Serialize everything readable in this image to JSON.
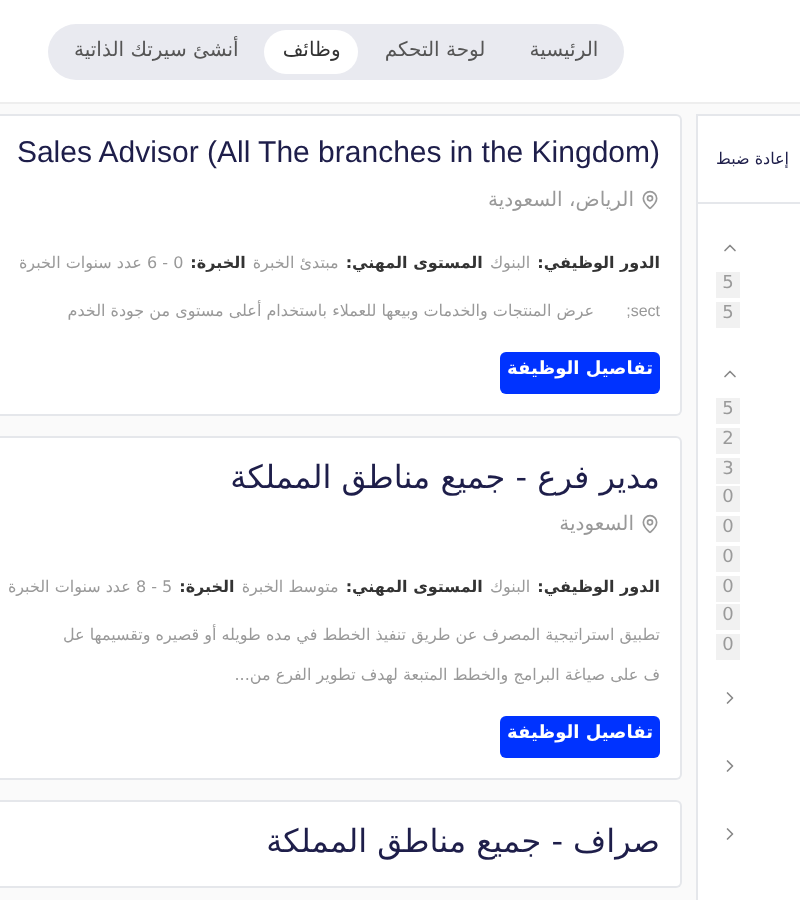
{
  "nav": {
    "items": [
      {
        "label": "الرئيسية",
        "selected": false
      },
      {
        "label": "لوحة التحكم",
        "selected": false
      },
      {
        "label": "وظائف",
        "selected": true
      },
      {
        "label": "أنشئ سيرتك الذاتية",
        "selected": false
      }
    ]
  },
  "jobs": [
    {
      "title": "Sales Advisor (All The branches in the Kingdom)",
      "kind": "latin",
      "location": "الرياض، السعودية",
      "meta": [
        {
          "label": "الدور الوظيفي:",
          "value": "البنوك"
        },
        {
          "label": "المستوى المهني:",
          "value": "مبتدئ الخبرة"
        },
        {
          "label": "الخبرة:",
          "value": "0 - 6 عدد سنوات الخبرة"
        }
      ],
      "description_prefix": "sect;",
      "description_lines": [
        "عرض المنتجات والخدمات وبيعها للعملاء باستخدام أعلى مستوى من جودة الخدم"
      ],
      "button": "تفاصيل الوظيفة"
    },
    {
      "title": "مدير فرع - جميع مناطق المملكة",
      "kind": "arabic",
      "location": "السعودية",
      "meta": [
        {
          "label": "الدور الوظيفي:",
          "value": "البنوك"
        },
        {
          "label": "المستوى المهني:",
          "value": "متوسط الخبرة"
        },
        {
          "label": "الخبرة:",
          "value": "5 - 8 عدد سنوات الخبرة"
        }
      ],
      "description_lines": [
        "تطبيق استراتيجية المصرف عن طريق تنفيذ الخطط في مده طويله أو قصيره وتقسيمها عل",
        "ف على صياغة البرامج والخطط المتبعة لهدف تطوير الفرع من..."
      ],
      "button": "تفاصيل الوظيفة"
    },
    {
      "title": "صراف - جميع مناطق المملكة",
      "kind": "arabic"
    }
  ],
  "sidebar": {
    "items": [
      {
        "kind": "reset",
        "text": "إعادة ضبط"
      },
      {
        "kind": "caret-up"
      },
      {
        "kind": "count",
        "text": "5"
      },
      {
        "kind": "count",
        "text": "5"
      },
      {
        "kind": "caret-up"
      },
      {
        "kind": "count",
        "text": "5"
      },
      {
        "kind": "count",
        "text": "2"
      },
      {
        "kind": "count",
        "text": "3"
      },
      {
        "kind": "count",
        "text": "0"
      },
      {
        "kind": "count",
        "text": "0"
      },
      {
        "kind": "count",
        "text": "0"
      },
      {
        "kind": "count",
        "text": "0"
      },
      {
        "kind": "count",
        "text": "0"
      },
      {
        "kind": "count",
        "text": "0"
      },
      {
        "kind": "chevron"
      },
      {
        "kind": "chevron"
      },
      {
        "kind": "chevron"
      }
    ]
  }
}
